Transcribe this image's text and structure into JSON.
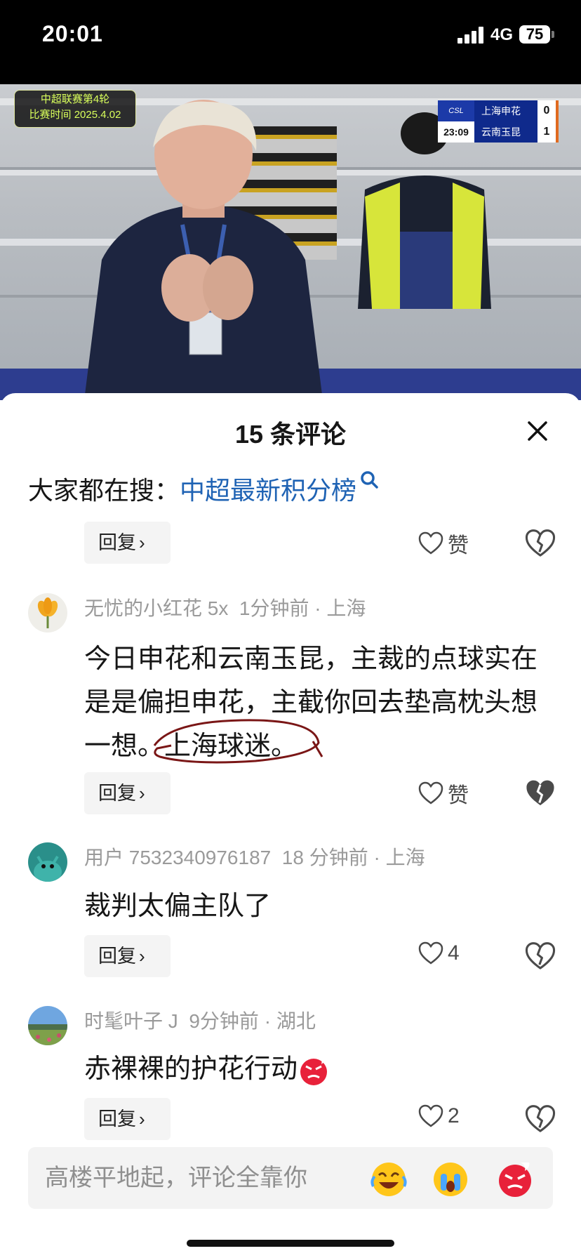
{
  "status_bar": {
    "time": "20:01",
    "network": "4G",
    "battery": "75"
  },
  "video": {
    "overlay_line1": "中超联赛第4轮",
    "overlay_line2": "比赛时间 2025.4.02",
    "scoreboard": {
      "league": "CSL",
      "clock": "23:09",
      "home_team": "上海申花",
      "home_score": "0",
      "away_team": "云南玉昆",
      "away_score": "1"
    }
  },
  "sheet": {
    "title": "15 条评论",
    "search_prefix": "大家都在搜：",
    "search_link": "中超最新积分榜"
  },
  "labels": {
    "reply": "回复",
    "like": "赞"
  },
  "comments": [
    {
      "user": "无忧的小红花 5x",
      "time": "1分钟前",
      "location": "上海",
      "text_a": "今日申花和云南玉昆，主裁的点球实在是是偏担申花，主截你回去垫高枕头想一想。",
      "text_b": "上海球迷。",
      "likes": "赞"
    },
    {
      "user": "用户 7532340976187",
      "time": "18 分钟前",
      "location": "上海",
      "text_a": "裁判太偏主队了",
      "likes": "4"
    },
    {
      "user": "时髦叶子 J",
      "time": "9分钟前",
      "location": "湖北",
      "text_a": "赤裸裸的护花行动",
      "likes": "2"
    }
  ],
  "input": {
    "placeholder": "高楼平地起，评论全靠你"
  },
  "icons": {
    "close": "close-icon",
    "search": "search-icon",
    "heart": "heart-icon",
    "broken_heart": "broken-heart-icon",
    "chevron": "chevron-right-icon",
    "emoji_laugh": "laughing-crying-emoji-icon",
    "emoji_cry": "crying-emoji-icon",
    "emoji_angry": "angry-emoji-icon"
  },
  "colors": {
    "link": "#1f63b4",
    "meta": "#9a9a9a",
    "annotation": "#7a1616"
  }
}
